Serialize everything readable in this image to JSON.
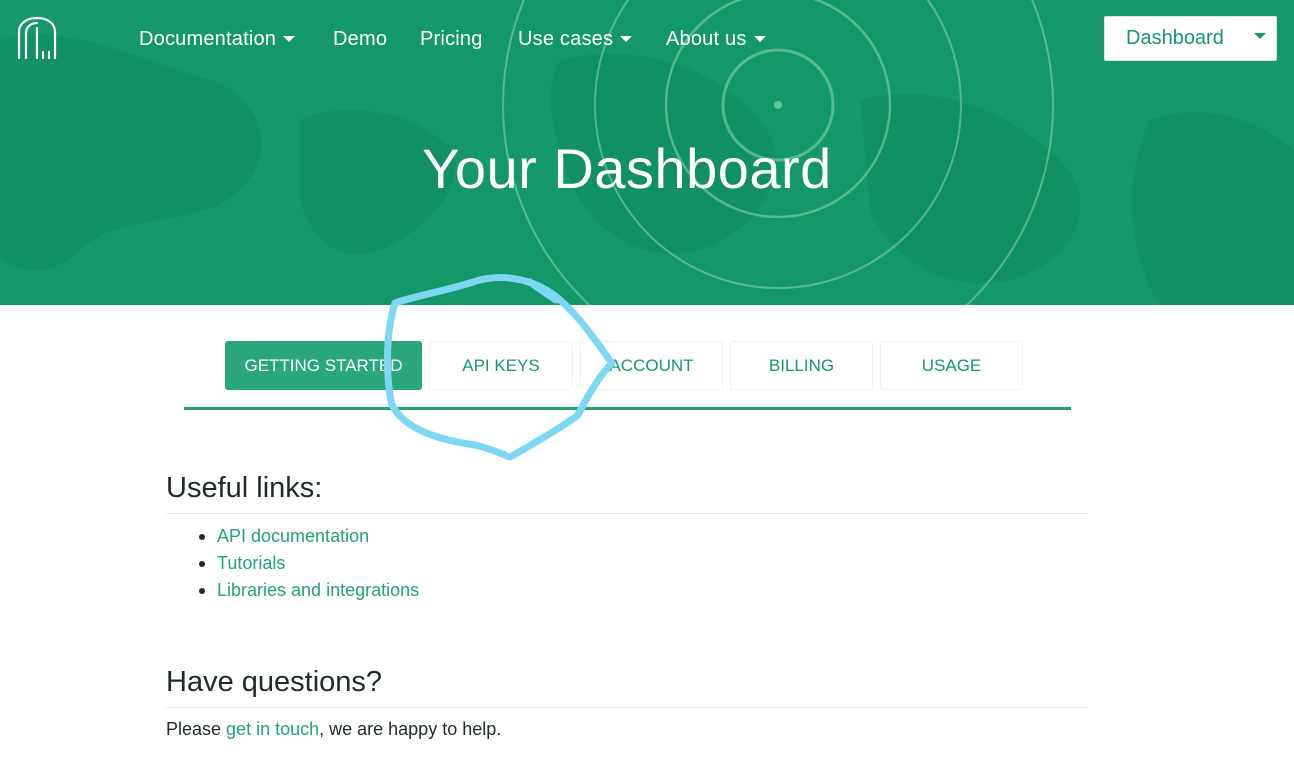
{
  "colors": {
    "brand": "#14986a",
    "brand_light": "#2aa77a",
    "link": "#22a374",
    "annotation": "#7dd6f2"
  },
  "logo": {
    "icon": "birdcage-logo-icon"
  },
  "nav": {
    "items": [
      {
        "label": "Documentation",
        "has_dropdown": true
      },
      {
        "label": "Demo",
        "has_dropdown": false
      },
      {
        "label": "Pricing",
        "has_dropdown": false
      },
      {
        "label": "Use cases",
        "has_dropdown": true
      },
      {
        "label": "About us",
        "has_dropdown": true
      }
    ],
    "dashboard_button": "Dashboard"
  },
  "hero": {
    "title": "Your Dashboard"
  },
  "tabs": {
    "items": [
      {
        "label": "GETTING STARTED",
        "active": true
      },
      {
        "label": "API KEYS",
        "active": false
      },
      {
        "label": "ACCOUNT",
        "active": false
      },
      {
        "label": "BILLING",
        "active": false
      },
      {
        "label": "USAGE",
        "active": false
      }
    ]
  },
  "useful_links": {
    "title": "Useful links:",
    "items": [
      "API documentation",
      "Tutorials",
      "Libraries and integrations"
    ]
  },
  "questions": {
    "title": "Have questions?",
    "text_before": "Please ",
    "link": "get in touch",
    "text_after": ", we are happy to help."
  }
}
